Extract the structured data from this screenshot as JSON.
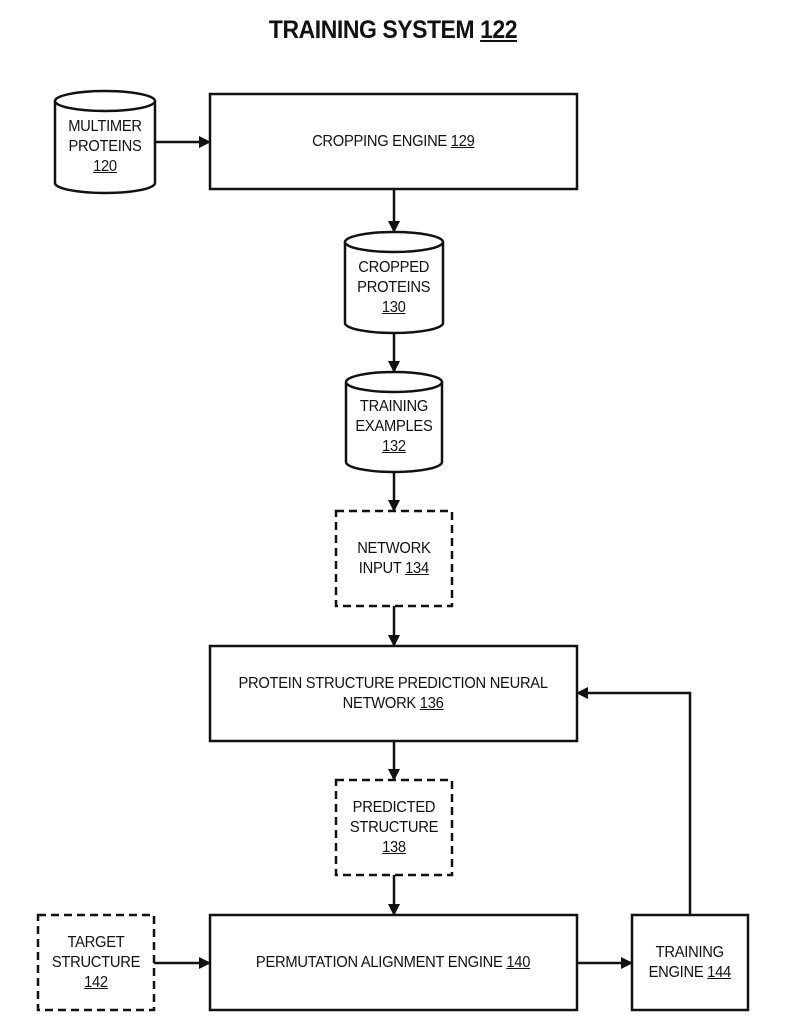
{
  "title": {
    "text": "TRAINING SYSTEM",
    "ref": "122"
  },
  "colors": {
    "stroke": "#111111",
    "background": "#ffffff"
  },
  "nodes": {
    "multimer_proteins": {
      "shape": "cylinder",
      "lines": [
        "MULTIMER",
        "PROTEINS"
      ],
      "ref": "120"
    },
    "cropping_engine": {
      "shape": "box",
      "lines": [
        "CROPPING ENGINE"
      ],
      "ref": "129"
    },
    "cropped_proteins": {
      "shape": "cylinder",
      "lines": [
        "CROPPED",
        "PROTEINS"
      ],
      "ref": "130"
    },
    "training_examples": {
      "shape": "cylinder",
      "lines": [
        "TRAINING",
        "EXAMPLES"
      ],
      "ref": "132"
    },
    "network_input": {
      "shape": "dashed-box",
      "lines": [
        "NETWORK",
        "INPUT"
      ],
      "ref": "134"
    },
    "neural_network": {
      "shape": "box",
      "lines": [
        "PROTEIN STRUCTURE PREDICTION NEURAL",
        "NETWORK"
      ],
      "ref": "136"
    },
    "predicted_structure": {
      "shape": "dashed-box",
      "lines": [
        "PREDICTED",
        "STRUCTURE"
      ],
      "ref": "138"
    },
    "permutation_alignment_engine": {
      "shape": "box",
      "lines": [
        "PERMUTATION ALIGNMENT ENGINE"
      ],
      "ref": "140"
    },
    "target_structure": {
      "shape": "dashed-box",
      "lines": [
        "TARGET",
        "STRUCTURE"
      ],
      "ref": "142"
    },
    "training_engine": {
      "shape": "box",
      "lines": [
        "TRAINING",
        "ENGINE"
      ],
      "ref": "144"
    }
  },
  "edges": [
    {
      "from": "multimer_proteins",
      "to": "cropping_engine"
    },
    {
      "from": "cropping_engine",
      "to": "cropped_proteins"
    },
    {
      "from": "cropped_proteins",
      "to": "training_examples"
    },
    {
      "from": "training_examples",
      "to": "network_input"
    },
    {
      "from": "network_input",
      "to": "neural_network"
    },
    {
      "from": "neural_network",
      "to": "predicted_structure"
    },
    {
      "from": "predicted_structure",
      "to": "permutation_alignment_engine"
    },
    {
      "from": "target_structure",
      "to": "permutation_alignment_engine"
    },
    {
      "from": "permutation_alignment_engine",
      "to": "training_engine"
    },
    {
      "from": "training_engine",
      "to": "neural_network"
    }
  ]
}
